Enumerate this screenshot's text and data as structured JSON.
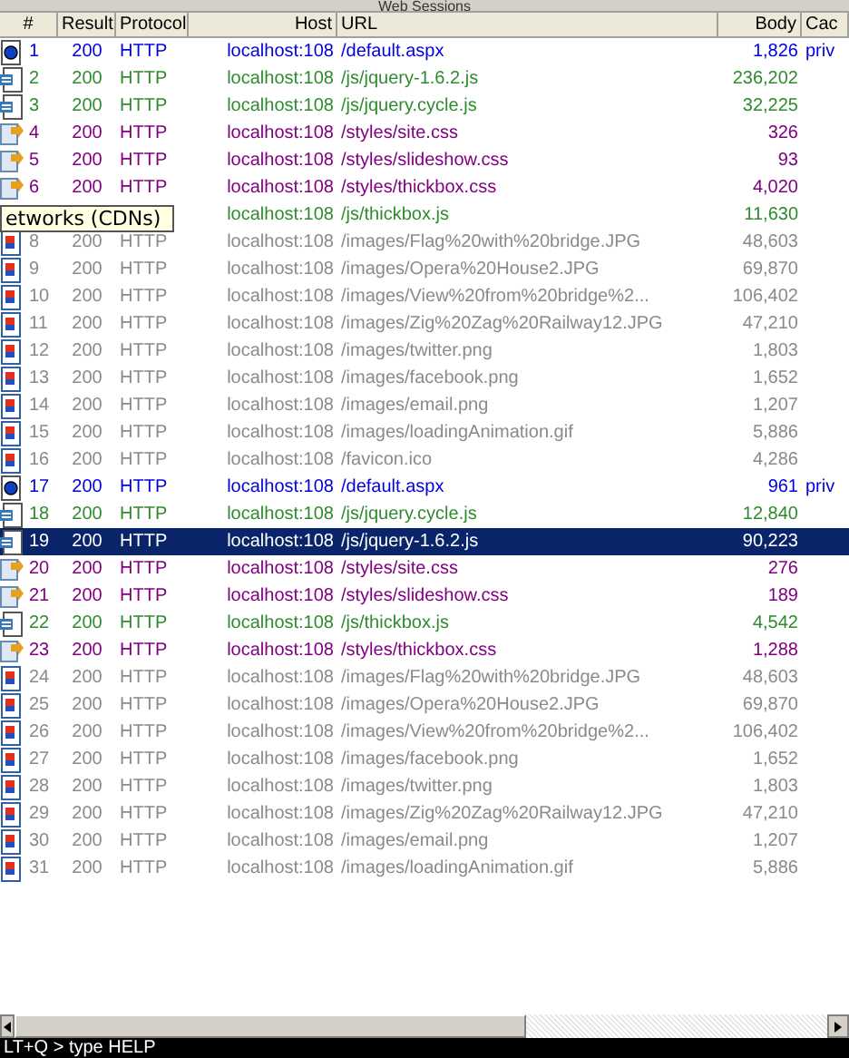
{
  "panel": {
    "title": "Web Sessions"
  },
  "columns": [
    "#",
    "Result",
    "Protocol",
    "Host",
    "URL",
    "Body",
    "Cac"
  ],
  "rows": [
    {
      "kind": "html",
      "num": "1",
      "result": "200",
      "protocol": "HTTP",
      "host": "localhost:108",
      "url": "/default.aspx",
      "body": "1,826",
      "caching": "priv",
      "selected": false
    },
    {
      "kind": "js",
      "num": "2",
      "result": "200",
      "protocol": "HTTP",
      "host": "localhost:108",
      "url": "/js/jquery-1.6.2.js",
      "body": "236,202",
      "selected": false
    },
    {
      "kind": "js",
      "num": "3",
      "result": "200",
      "protocol": "HTTP",
      "host": "localhost:108",
      "url": "/js/jquery.cycle.js",
      "body": "32,225",
      "selected": false
    },
    {
      "kind": "css",
      "num": "4",
      "result": "200",
      "protocol": "HTTP",
      "host": "localhost:108",
      "url": "/styles/site.css",
      "body": "326",
      "selected": false
    },
    {
      "kind": "css",
      "num": "5",
      "result": "200",
      "protocol": "HTTP",
      "host": "localhost:108",
      "url": "/styles/slideshow.css",
      "body": "93",
      "selected": false
    },
    {
      "kind": "css",
      "num": "6",
      "result": "200",
      "protocol": "HTTP",
      "host": "localhost:108",
      "url": "/styles/thickbox.css",
      "body": "4,020",
      "selected": false
    },
    {
      "kind": "js",
      "host": "localhost:108",
      "url": "/js/thickbox.js",
      "body": "11,630",
      "selected": false
    },
    {
      "kind": "image",
      "num": "8",
      "result": "200",
      "protocol": "HTTP",
      "host": "localhost:108",
      "url": "/images/Flag%20with%20bridge.JPG",
      "body": "48,603",
      "selected": false
    },
    {
      "kind": "image",
      "num": "9",
      "result": "200",
      "protocol": "HTTP",
      "host": "localhost:108",
      "url": "/images/Opera%20House2.JPG",
      "body": "69,870",
      "selected": false
    },
    {
      "kind": "image",
      "num": "10",
      "result": "200",
      "protocol": "HTTP",
      "host": "localhost:108",
      "url": "/images/View%20from%20bridge%2...",
      "body": "106,402",
      "selected": false
    },
    {
      "kind": "image",
      "num": "11",
      "result": "200",
      "protocol": "HTTP",
      "host": "localhost:108",
      "url": "/images/Zig%20Zag%20Railway12.JPG",
      "body": "47,210",
      "selected": false
    },
    {
      "kind": "image",
      "num": "12",
      "result": "200",
      "protocol": "HTTP",
      "host": "localhost:108",
      "url": "/images/twitter.png",
      "body": "1,803",
      "selected": false
    },
    {
      "kind": "image",
      "num": "13",
      "result": "200",
      "protocol": "HTTP",
      "host": "localhost:108",
      "url": "/images/facebook.png",
      "body": "1,652",
      "selected": false
    },
    {
      "kind": "image",
      "num": "14",
      "result": "200",
      "protocol": "HTTP",
      "host": "localhost:108",
      "url": "/images/email.png",
      "body": "1,207",
      "selected": false
    },
    {
      "kind": "image",
      "num": "15",
      "result": "200",
      "protocol": "HTTP",
      "host": "localhost:108",
      "url": "/images/loadingAnimation.gif",
      "body": "5,886",
      "selected": false
    },
    {
      "kind": "image",
      "num": "16",
      "result": "200",
      "protocol": "HTTP",
      "host": "localhost:108",
      "url": "/favicon.ico",
      "body": "4,286",
      "selected": false
    },
    {
      "kind": "html",
      "num": "17",
      "result": "200",
      "protocol": "HTTP",
      "host": "localhost:108",
      "url": "/default.aspx",
      "body": "961",
      "caching": "priv",
      "selected": false
    },
    {
      "kind": "js",
      "num": "18",
      "result": "200",
      "protocol": "HTTP",
      "host": "localhost:108",
      "url": "/js/jquery.cycle.js",
      "body": "12,840",
      "selected": false
    },
    {
      "kind": "js",
      "num": "19",
      "result": "200",
      "protocol": "HTTP",
      "host": "localhost:108",
      "url": "/js/jquery-1.6.2.js",
      "body": "90,223",
      "selected": true
    },
    {
      "kind": "css",
      "num": "20",
      "result": "200",
      "protocol": "HTTP",
      "host": "localhost:108",
      "url": "/styles/site.css",
      "body": "276",
      "selected": false
    },
    {
      "kind": "css",
      "num": "21",
      "result": "200",
      "protocol": "HTTP",
      "host": "localhost:108",
      "url": "/styles/slideshow.css",
      "body": "189",
      "selected": false
    },
    {
      "kind": "js",
      "num": "22",
      "result": "200",
      "protocol": "HTTP",
      "host": "localhost:108",
      "url": "/js/thickbox.js",
      "body": "4,542",
      "selected": false
    },
    {
      "kind": "css",
      "num": "23",
      "result": "200",
      "protocol": "HTTP",
      "host": "localhost:108",
      "url": "/styles/thickbox.css",
      "body": "1,288",
      "selected": false
    },
    {
      "kind": "image",
      "num": "24",
      "result": "200",
      "protocol": "HTTP",
      "host": "localhost:108",
      "url": "/images/Flag%20with%20bridge.JPG",
      "body": "48,603",
      "selected": false
    },
    {
      "kind": "image",
      "num": "25",
      "result": "200",
      "protocol": "HTTP",
      "host": "localhost:108",
      "url": "/images/Opera%20House2.JPG",
      "body": "69,870",
      "selected": false
    },
    {
      "kind": "image",
      "num": "26",
      "result": "200",
      "protocol": "HTTP",
      "host": "localhost:108",
      "url": "/images/View%20from%20bridge%2...",
      "body": "106,402",
      "selected": false
    },
    {
      "kind": "image",
      "num": "27",
      "result": "200",
      "protocol": "HTTP",
      "host": "localhost:108",
      "url": "/images/facebook.png",
      "body": "1,652",
      "selected": false
    },
    {
      "kind": "image",
      "num": "28",
      "result": "200",
      "protocol": "HTTP",
      "host": "localhost:108",
      "url": "/images/twitter.png",
      "body": "1,803",
      "selected": false
    },
    {
      "kind": "image",
      "num": "29",
      "result": "200",
      "protocol": "HTTP",
      "host": "localhost:108",
      "url": "/images/Zig%20Zag%20Railway12.JPG",
      "body": "47,210",
      "selected": false
    },
    {
      "kind": "image",
      "num": "30",
      "result": "200",
      "protocol": "HTTP",
      "host": "localhost:108",
      "url": "/images/email.png",
      "body": "1,207",
      "selected": false
    },
    {
      "kind": "image",
      "num": "31",
      "result": "200",
      "protocol": "HTTP",
      "host": "localhost:108",
      "url": "/images/loadingAnimation.gif",
      "body": "5,886",
      "selected": false
    }
  ],
  "tooltip": "etworks (CDNs)",
  "status_bar": "LT+Q > type HELP"
}
